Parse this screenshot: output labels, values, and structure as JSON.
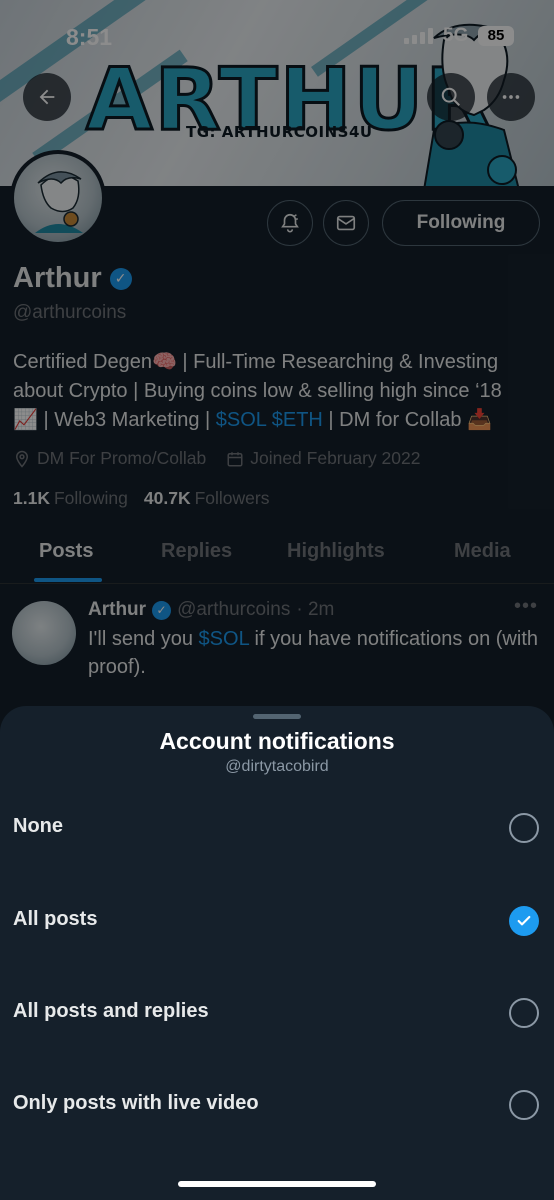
{
  "status_bar": {
    "time": "8:51",
    "network": "5G",
    "battery": "85"
  },
  "banner": {
    "title": "ARTHUR",
    "subtitle": "TG: ARTHURCOINS4U"
  },
  "profile": {
    "name": "Arthur",
    "handle": "@arthurcoins",
    "following_button": "Following",
    "bio": {
      "line1": "Certified Degen🧠 | Full-Time Researching & Investing",
      "line2": "about Crypto | Buying coins low & selling high since ‘18",
      "line3_pre": "📈 | Web3 Marketing | ",
      "line3_tickers": "$SOL $ETH",
      "line3_post": " | DM for Collab 📥"
    },
    "location": "DM For Promo/Collab",
    "joined": "Joined February 2022",
    "following_count": "1.1K",
    "following_label": "Following",
    "followers_count": "40.7K",
    "followers_label": "Followers"
  },
  "tabs": [
    "Posts",
    "Replies",
    "Highlights",
    "Media"
  ],
  "post": {
    "name": "Arthur",
    "handle": "@arthurcoins",
    "time": "· 2m",
    "text_pre": "I'll send you ",
    "text_ticker": "$SOL",
    "text_post": " if you have notifications on (with proof)."
  },
  "sheet": {
    "title": "Account notifications",
    "subtitle": "@dirtytacobird",
    "options": [
      {
        "label": "None",
        "selected": false
      },
      {
        "label": "All posts",
        "selected": true
      },
      {
        "label": "All posts and replies",
        "selected": false
      },
      {
        "label": "Only posts with live video",
        "selected": false
      }
    ]
  },
  "colors": {
    "accent": "#1d9bf0",
    "background": "#15202b",
    "muted": "#71767b"
  },
  "icons": [
    "back-arrow-icon",
    "search-icon",
    "more-icon",
    "notification-bell-icon",
    "mail-icon",
    "verified-badge-icon",
    "location-icon",
    "calendar-icon",
    "checkmark-icon"
  ]
}
